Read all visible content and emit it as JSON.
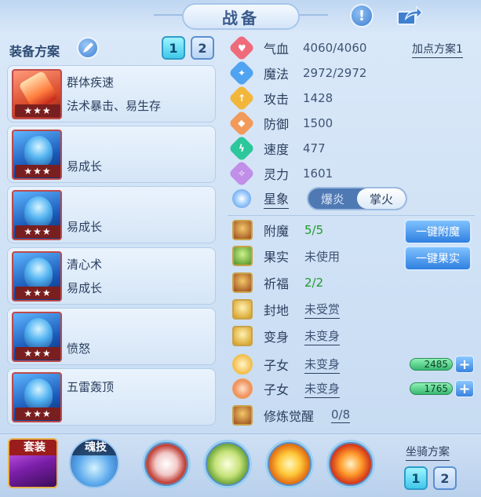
{
  "header": {
    "title": "战备",
    "info_button_glyph": "!",
    "info_icon": "exclamation-icon",
    "share_icon": "share-icon"
  },
  "left": {
    "plan_label": "装备方案",
    "edit_icon": "pencil-icon",
    "plan_numbers": [
      "1",
      "2"
    ],
    "active_plan": "1",
    "cards": [
      {
        "line1": "群体疾速",
        "line2": "法术暴击、易生存",
        "stars": "★★★"
      },
      {
        "line1": "",
        "line2": "易成长",
        "stars": "★★★"
      },
      {
        "line1": "",
        "line2": "易成长",
        "stars": "★★★"
      },
      {
        "line1": "清心术",
        "line2": "易成长",
        "stars": "★★★"
      },
      {
        "line1": "",
        "line2": "愤怒",
        "stars": "★★★"
      },
      {
        "line1": "五雷轰顶",
        "line2": "",
        "stars": "★★★"
      }
    ]
  },
  "stats": {
    "plan_link": "加点方案1",
    "rows": [
      {
        "name": "气血",
        "value": "4060/4060",
        "color": "#ef6b7b",
        "icon": "heart-icon",
        "glyph": "♥"
      },
      {
        "name": "魔法",
        "value": "2972/2972",
        "color": "#4fa3f0",
        "icon": "magic-icon",
        "glyph": "✦"
      },
      {
        "name": "攻击",
        "value": "1428",
        "color": "#f2b63a",
        "icon": "attack-icon",
        "glyph": "↑"
      },
      {
        "name": "防御",
        "value": "1500",
        "color": "#f29a5a",
        "icon": "shield-icon",
        "glyph": "◆"
      },
      {
        "name": "速度",
        "value": "477",
        "color": "#2cc79a",
        "icon": "speed-icon",
        "glyph": "ϟ"
      },
      {
        "name": "灵力",
        "value": "1601",
        "color": "#c18ee8",
        "icon": "spirit-icon",
        "glyph": "✧"
      }
    ],
    "star_label": "星象",
    "star_icon": "star-sign-icon",
    "star_options": [
      "爆炎",
      "掌火"
    ],
    "star_selected": "掌火"
  },
  "features": [
    {
      "name": "附魔",
      "value": "5/5",
      "icon": "enchant-icon"
    },
    {
      "name": "果实",
      "value": "未使用",
      "icon": "fruit-icon"
    },
    {
      "name": "祈福",
      "value": "2/2",
      "icon": "blessing-icon"
    },
    {
      "name": "封地",
      "value": "未受赏",
      "icon": "fief-icon"
    },
    {
      "name": "变身",
      "value": "未变身",
      "icon": "transform-icon"
    },
    {
      "name": "子女",
      "value": "未变身",
      "icon": "child-icon-1"
    },
    {
      "name": "子女",
      "value": "未变身",
      "icon": "child-icon-2"
    },
    {
      "name": "修炼觉醒",
      "value": "0/8",
      "icon": "cultivation-icon"
    }
  ],
  "actions": {
    "enchant_button": "一键附魔",
    "fruit_button": "一键果实"
  },
  "gauges": [
    {
      "value": "2485"
    },
    {
      "value": "1765"
    }
  ],
  "plus_glyph": "+",
  "bottom": {
    "tab_set": "套装",
    "tab_soul": "魂技",
    "skills": [
      "wind-blade-skill-icon",
      "nature-skill-icon",
      "fire-burst-skill-icon",
      "flame-skill-icon"
    ],
    "mount_label": "坐骑方案",
    "mount_numbers": [
      "1",
      "2"
    ],
    "active_mount": "1"
  }
}
